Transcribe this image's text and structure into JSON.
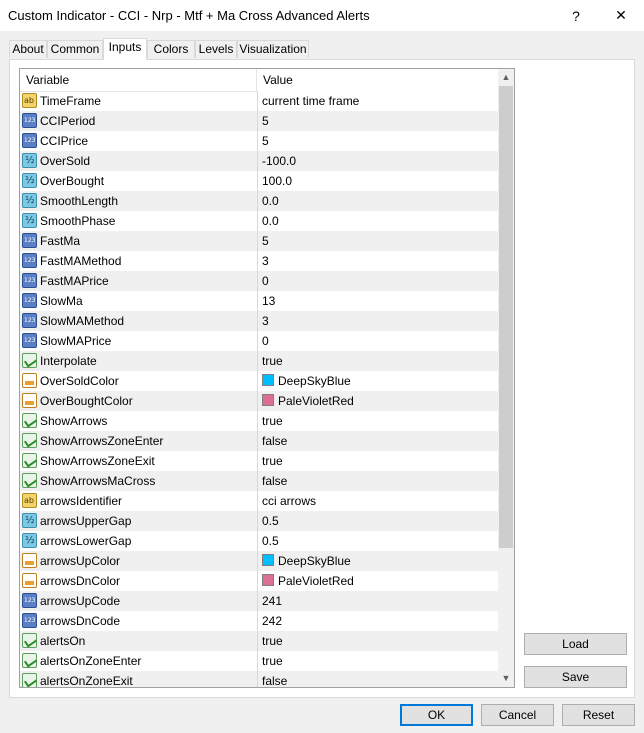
{
  "window": {
    "title": "Custom Indicator - CCI - Nrp - Mtf + Ma Cross Advanced Alerts",
    "help_label": "?",
    "close_label": "✕"
  },
  "tabs": [
    {
      "label": "About",
      "active": false
    },
    {
      "label": "Common",
      "active": false
    },
    {
      "label": "Inputs",
      "active": true
    },
    {
      "label": "Colors",
      "active": false
    },
    {
      "label": "Levels",
      "active": false
    },
    {
      "label": "Visualization",
      "active": false
    }
  ],
  "grid": {
    "columns": {
      "variable": "Variable",
      "value": "Value"
    },
    "rows": [
      {
        "type": "ab",
        "name": "TimeFrame",
        "value": "current time frame"
      },
      {
        "type": "123",
        "name": "CCIPeriod",
        "value": "5"
      },
      {
        "type": "123",
        "name": "CCIPrice",
        "value": "5"
      },
      {
        "type": "frac",
        "name": "OverSold",
        "value": "-100.0"
      },
      {
        "type": "frac",
        "name": "OverBought",
        "value": "100.0"
      },
      {
        "type": "frac",
        "name": "SmoothLength",
        "value": "0.0"
      },
      {
        "type": "frac",
        "name": "SmoothPhase",
        "value": "0.0"
      },
      {
        "type": "123",
        "name": "FastMa",
        "value": "5"
      },
      {
        "type": "123",
        "name": "FastMAMethod",
        "value": "3"
      },
      {
        "type": "123",
        "name": "FastMAPrice",
        "value": "0"
      },
      {
        "type": "123",
        "name": "SlowMa",
        "value": "13"
      },
      {
        "type": "123",
        "name": "SlowMAMethod",
        "value": "3"
      },
      {
        "type": "123",
        "name": "SlowMAPrice",
        "value": "0"
      },
      {
        "type": "bool",
        "name": "Interpolate",
        "value": "true"
      },
      {
        "type": "color",
        "name": "OverSoldColor",
        "value": "DeepSkyBlue",
        "swatch": "#00bfff"
      },
      {
        "type": "color",
        "name": "OverBoughtColor",
        "value": "PaleVioletRed",
        "swatch": "#db7093"
      },
      {
        "type": "bool",
        "name": "ShowArrows",
        "value": "true"
      },
      {
        "type": "bool",
        "name": "ShowArrowsZoneEnter",
        "value": "false"
      },
      {
        "type": "bool",
        "name": "ShowArrowsZoneExit",
        "value": "true"
      },
      {
        "type": "bool",
        "name": "ShowArrowsMaCross",
        "value": "false"
      },
      {
        "type": "ab",
        "name": "arrowsIdentifier",
        "value": "cci arrows"
      },
      {
        "type": "frac",
        "name": "arrowsUpperGap",
        "value": "0.5"
      },
      {
        "type": "frac",
        "name": "arrowsLowerGap",
        "value": "0.5"
      },
      {
        "type": "color",
        "name": "arrowsUpColor",
        "value": "DeepSkyBlue",
        "swatch": "#00bfff"
      },
      {
        "type": "color",
        "name": "arrowsDnColor",
        "value": "PaleVioletRed",
        "swatch": "#db7093"
      },
      {
        "type": "123",
        "name": "arrowsUpCode",
        "value": "241"
      },
      {
        "type": "123",
        "name": "arrowsDnCode",
        "value": "242"
      },
      {
        "type": "bool",
        "name": "alertsOn",
        "value": "true"
      },
      {
        "type": "bool",
        "name": "alertsOnZoneEnter",
        "value": "true"
      },
      {
        "type": "bool",
        "name": "alertsOnZoneExit",
        "value": "false"
      }
    ]
  },
  "buttons": {
    "load": "Load",
    "save": "Save",
    "ok": "OK",
    "cancel": "Cancel",
    "reset": "Reset"
  },
  "scrollbar": {
    "up_arrow": "▲",
    "down_arrow": "▼"
  }
}
